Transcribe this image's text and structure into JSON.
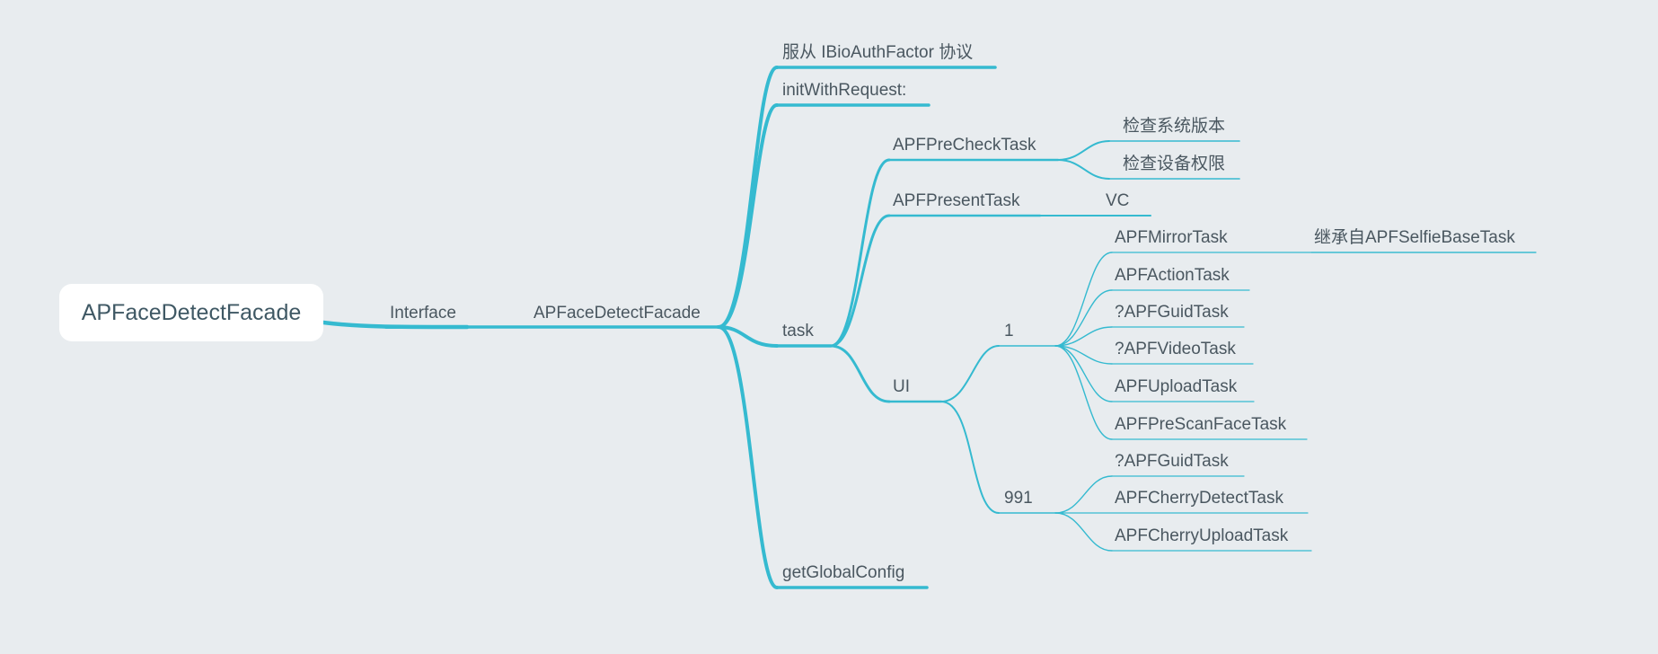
{
  "colors": {
    "background": "#e8ecef",
    "line": "#35bad0",
    "text": "#4a5760",
    "root_text": "#3f5864",
    "root_fill": "#ffffff"
  },
  "root": {
    "label": "APFaceDetectFacade"
  },
  "nodes": {
    "interface": "Interface",
    "facade": "APFaceDetectFacade",
    "protocol": "服从 IBioAuthFactor 协议",
    "init": "initWithRequest:",
    "task": "task",
    "global_config": "getGlobalConfig",
    "precheck": "APFPreCheckTask",
    "check_version": "检查系统版本",
    "check_permission": "检查设备权限",
    "present": "APFPresentTask",
    "vc": "VC",
    "ui": "UI",
    "group_1": "1",
    "group_991": "991",
    "mirror": "APFMirrorTask",
    "mirror_note": "继承自APFSelfieBaseTask",
    "action": "APFActionTask",
    "guid_1": "?APFGuidTask",
    "video": "?APFVideoTask",
    "upload": "APFUploadTask",
    "prescan": "APFPreScanFaceTask",
    "guid_991": "?APFGuidTask",
    "cherry_detect": "APFCherryDetectTask",
    "cherry_upload": "APFCherryUploadTask"
  }
}
